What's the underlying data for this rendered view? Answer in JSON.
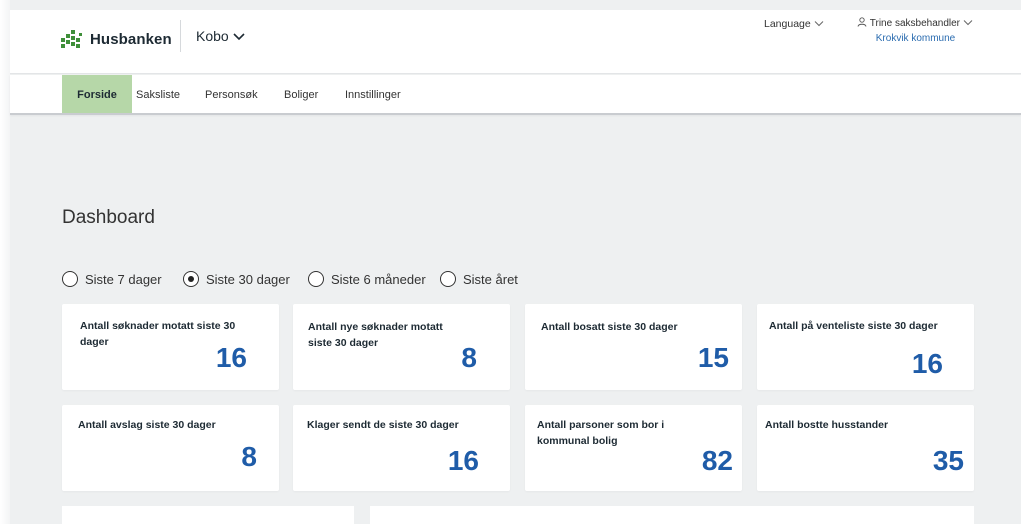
{
  "header": {
    "brand": "Husbanken",
    "app_switch": "Kobo",
    "language": "Language",
    "user_name": "Trine saksbehandler",
    "user_org": "Krokvik kommune"
  },
  "nav": {
    "tabs": [
      {
        "label": "Forside",
        "active": true
      },
      {
        "label": "Saksliste",
        "active": false
      },
      {
        "label": "Personsøk",
        "active": false
      },
      {
        "label": "Boliger",
        "active": false
      },
      {
        "label": "Innstillinger",
        "active": false
      }
    ]
  },
  "dashboard": {
    "title": "Dashboard",
    "filters": [
      {
        "label": "Siste 7 dager",
        "checked": false
      },
      {
        "label": "Siste 30 dager",
        "checked": true
      },
      {
        "label": "Siste 6 måneder",
        "checked": false
      },
      {
        "label": "Siste året",
        "checked": false
      }
    ],
    "cards": [
      {
        "label": "Antall søknader motatt siste 30 dager",
        "value": "16"
      },
      {
        "label": "Antall nye søknader motatt siste 30 dager",
        "value": "8"
      },
      {
        "label": "Antall bosatt siste 30 dager",
        "value": "15"
      },
      {
        "label": "Antall på venteliste siste 30 dager",
        "value": "16"
      },
      {
        "label": "Antall avslag siste 30 dager",
        "value": "8"
      },
      {
        "label": "Klager sendt de siste 30 dager",
        "value": "16"
      },
      {
        "label": "Antall parsoner som bor i kommunal bolig",
        "value": "82"
      },
      {
        "label": "Antall bostte husstander",
        "value": "35"
      }
    ]
  },
  "colors": {
    "accent_tab": "#b6d7a8",
    "value_blue": "#1f5ca8",
    "link_blue": "#2b6cb0",
    "background": "#eef0f1"
  },
  "icons": [
    "husbanken-logo-icon",
    "chevron-down-icon",
    "user-icon"
  ]
}
